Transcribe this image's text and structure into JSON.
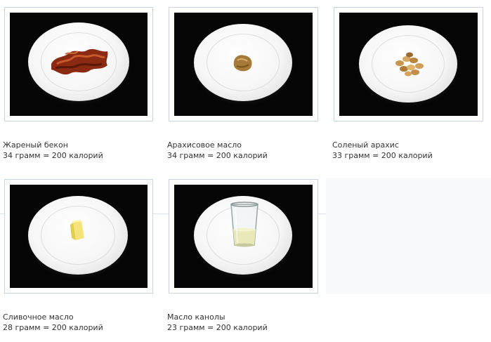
{
  "items": [
    {
      "name": "Жареный бекон",
      "amount": "34 грамм = 200 калорий",
      "food_icon": "bacon-icon"
    },
    {
      "name": "Арахисовое масло",
      "amount": "34 грамм = 200 калорий",
      "food_icon": "peanut-butter-icon"
    },
    {
      "name": "Соленый арахис",
      "amount": "33 грамм = 200 калорий",
      "food_icon": "peanuts-icon"
    },
    {
      "name": "Сливочное масло",
      "amount": "28 грамм = 200 калорий",
      "food_icon": "butter-icon"
    },
    {
      "name": "Масло канолы",
      "amount": "23 грамм = 200 калорий",
      "food_icon": "canola-oil-glass-icon"
    }
  ],
  "colors": {
    "photo_background": "#050505",
    "card_border": "#c9d4e2",
    "caption_text": "#333333"
  }
}
